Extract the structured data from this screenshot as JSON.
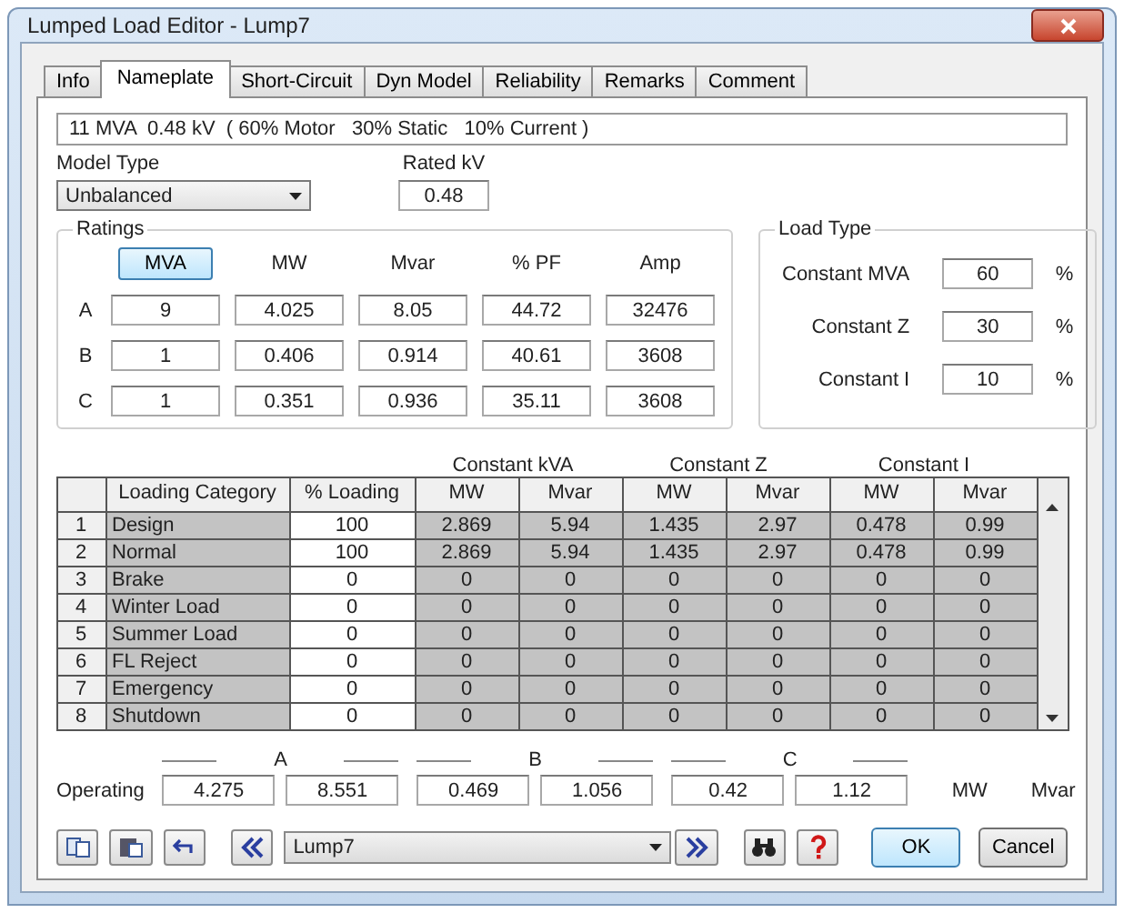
{
  "window": {
    "title": "Lumped Load Editor - Lump7"
  },
  "tabs": [
    {
      "label": "Info",
      "selected": false
    },
    {
      "label": "Nameplate",
      "selected": true
    },
    {
      "label": "Short-Circuit",
      "selected": false
    },
    {
      "label": "Dyn Model",
      "selected": false
    },
    {
      "label": "Reliability",
      "selected": false
    },
    {
      "label": "Remarks",
      "selected": false
    },
    {
      "label": "Comment",
      "selected": false
    }
  ],
  "summary": "11 MVA  0.48 kV  ( 60% Motor   30% Static   10% Current )",
  "model_type": {
    "label": "Model Type",
    "value": "Unbalanced"
  },
  "rated_kv": {
    "label": "Rated kV",
    "value": "0.48"
  },
  "ratings": {
    "title": "Ratings",
    "unit_button": "MVA",
    "columns": [
      "MW",
      "Mvar",
      "% PF",
      "Amp"
    ],
    "rows": [
      {
        "phase": "A",
        "values": [
          "9",
          "4.025",
          "8.05",
          "44.72",
          "32476"
        ]
      },
      {
        "phase": "B",
        "values": [
          "1",
          "0.406",
          "0.914",
          "40.61",
          "3608"
        ]
      },
      {
        "phase": "C",
        "values": [
          "1",
          "0.351",
          "0.936",
          "35.11",
          "3608"
        ]
      }
    ]
  },
  "load_type": {
    "title": "Load Type",
    "items": [
      {
        "label": "Constant MVA",
        "value": "60",
        "unit": "%"
      },
      {
        "label": "Constant Z",
        "value": "30",
        "unit": "%"
      },
      {
        "label": "Constant I",
        "value": "10",
        "unit": "%"
      }
    ]
  },
  "grid": {
    "group_headers": [
      "Constant kVA",
      "Constant Z",
      "Constant I"
    ],
    "columns": [
      "Loading Category",
      "% Loading",
      "MW",
      "Mvar",
      "MW",
      "Mvar",
      "MW",
      "Mvar"
    ],
    "rows": [
      {
        "number": "1",
        "cells": [
          "Design",
          "100",
          "2.869",
          "5.94",
          "1.435",
          "2.97",
          "0.478",
          "0.99"
        ]
      },
      {
        "number": "2",
        "cells": [
          "Normal",
          "100",
          "2.869",
          "5.94",
          "1.435",
          "2.97",
          "0.478",
          "0.99"
        ]
      },
      {
        "number": "3",
        "cells": [
          "Brake",
          "0",
          "0",
          "0",
          "0",
          "0",
          "0",
          "0"
        ]
      },
      {
        "number": "4",
        "cells": [
          "Winter Load",
          "0",
          "0",
          "0",
          "0",
          "0",
          "0",
          "0"
        ]
      },
      {
        "number": "5",
        "cells": [
          "Summer Load",
          "0",
          "0",
          "0",
          "0",
          "0",
          "0",
          "0"
        ]
      },
      {
        "number": "6",
        "cells": [
          "FL Reject",
          "0",
          "0",
          "0",
          "0",
          "0",
          "0",
          "0"
        ]
      },
      {
        "number": "7",
        "cells": [
          "Emergency",
          "0",
          "0",
          "0",
          "0",
          "0",
          "0",
          "0"
        ]
      },
      {
        "number": "8",
        "cells": [
          "Shutdown",
          "0",
          "0",
          "0",
          "0",
          "0",
          "0",
          "0"
        ]
      }
    ]
  },
  "operating": {
    "label": "Operating",
    "groups": [
      {
        "phase": "A",
        "mw": "4.275",
        "mvar": "8.551"
      },
      {
        "phase": "B",
        "mw": "0.469",
        "mvar": "1.056"
      },
      {
        "phase": "C",
        "mw": "0.42",
        "mvar": "1.12"
      }
    ],
    "units": [
      "MW",
      "Mvar"
    ]
  },
  "footer": {
    "element": "Lump7",
    "buttons": [
      {
        "label": "OK",
        "kind": "default"
      },
      {
        "label": "Cancel",
        "kind": "normal"
      }
    ]
  }
}
